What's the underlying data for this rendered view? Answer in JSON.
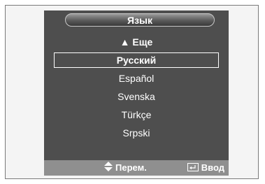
{
  "menu": {
    "title": "Язык",
    "more_label": "▲ Еще",
    "items": [
      {
        "label": "Русский"
      },
      {
        "label": "Español"
      },
      {
        "label": "Svenska"
      },
      {
        "label": "Türkçe"
      },
      {
        "label": "Srpski"
      }
    ],
    "selected_index": 0
  },
  "footer": {
    "move_label": "Перем.",
    "enter_label": "Ввод",
    "move_icon": "up-down-arrows-icon",
    "enter_icon": "enter-icon"
  }
}
